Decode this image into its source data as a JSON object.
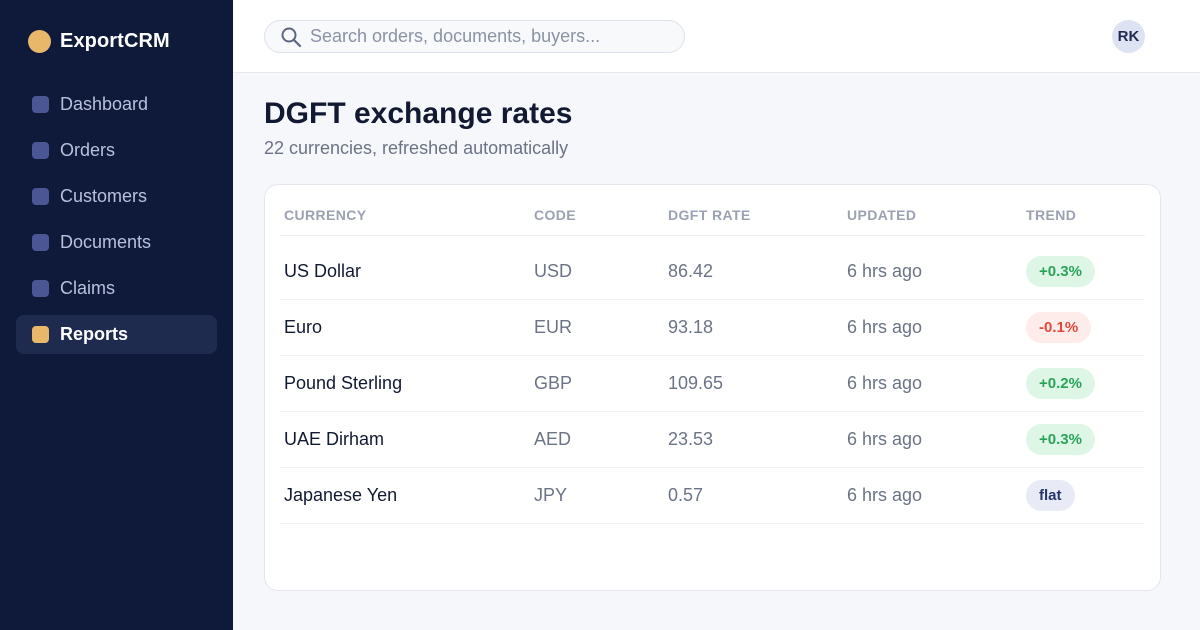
{
  "brand": {
    "name": "ExportCRM"
  },
  "nav": {
    "items": [
      {
        "label": "Dashboard",
        "active": false
      },
      {
        "label": "Orders",
        "active": false
      },
      {
        "label": "Customers",
        "active": false
      },
      {
        "label": "Documents",
        "active": false
      },
      {
        "label": "Claims",
        "active": false
      },
      {
        "label": "Reports",
        "active": true
      }
    ]
  },
  "search": {
    "placeholder": "Search orders, documents, buyers..."
  },
  "user": {
    "initials": "RK"
  },
  "page": {
    "title": "DGFT exchange rates",
    "subtitle": "22 currencies, refreshed automatically"
  },
  "table": {
    "headers": {
      "currency": "CURRENCY",
      "code": "CODE",
      "rate": "DGFT RATE",
      "updated": "UPDATED",
      "trend": "TREND"
    },
    "rows": [
      {
        "currency": "US Dollar",
        "code": "USD",
        "rate": "86.42",
        "updated": "6 hrs ago",
        "trend": "+0.3%",
        "trend_type": "up"
      },
      {
        "currency": "Euro",
        "code": "EUR",
        "rate": "93.18",
        "updated": "6 hrs ago",
        "trend": "-0.1%",
        "trend_type": "down"
      },
      {
        "currency": "Pound Sterling",
        "code": "GBP",
        "rate": "109.65",
        "updated": "6 hrs ago",
        "trend": "+0.2%",
        "trend_type": "up"
      },
      {
        "currency": "UAE Dirham",
        "code": "AED",
        "rate": "23.53",
        "updated": "6 hrs ago",
        "trend": "+0.3%",
        "trend_type": "up"
      },
      {
        "currency": "Japanese Yen",
        "code": "JPY",
        "rate": "0.57",
        "updated": "6 hrs ago",
        "trend": "flat",
        "trend_type": "flat"
      }
    ]
  },
  "colors": {
    "sidebar_bg": "#0f1a3b",
    "accent": "#e8b76a",
    "positive": "#2aa35a",
    "negative": "#e04a3c"
  },
  "icons": {
    "brand": "brand-logo-icon",
    "search": "search-icon",
    "nav": "nav-square-icon"
  }
}
